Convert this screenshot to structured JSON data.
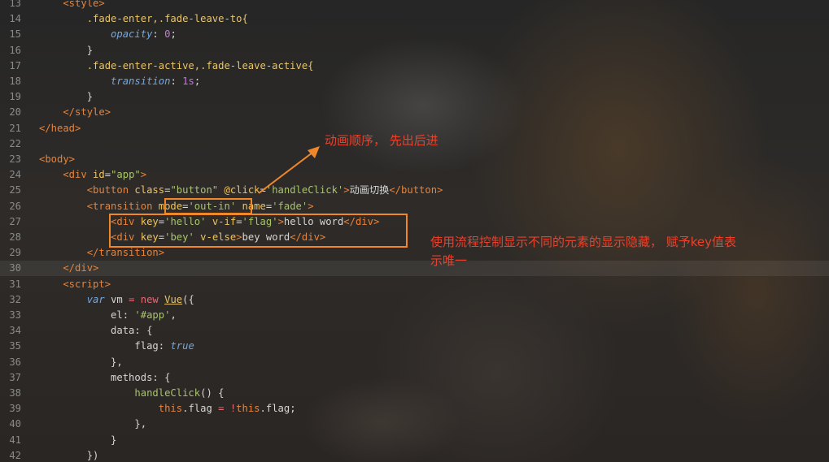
{
  "editor": {
    "line_numbers": [
      "13",
      "14",
      "15",
      "16",
      "17",
      "18",
      "19",
      "20",
      "21",
      "22",
      "23",
      "24",
      "25",
      "26",
      "27",
      "28",
      "29",
      "30",
      "31",
      "32",
      "33",
      "34",
      "35",
      "36",
      "37",
      "38",
      "39",
      "40",
      "41",
      "42"
    ],
    "active_line": "30",
    "lines": [
      [
        [
          "t-tag",
          "    <style>"
        ]
      ],
      [
        [
          "t-sel",
          "        .fade-enter,.fade-leave-to{"
        ]
      ],
      [
        [
          "t-prop",
          "            opacity"
        ],
        [
          "t-pl",
          ": "
        ],
        [
          "t-num",
          "0"
        ],
        [
          "t-pl",
          ";"
        ]
      ],
      [
        [
          "t-pl",
          "        }"
        ]
      ],
      [
        [
          "t-sel",
          "        .fade-enter-active,.fade-leave-active{"
        ]
      ],
      [
        [
          "t-prop",
          "            transition"
        ],
        [
          "t-pl",
          ": "
        ],
        [
          "t-num",
          "1s"
        ],
        [
          "t-pl",
          ";"
        ]
      ],
      [
        [
          "t-pl",
          "        }"
        ]
      ],
      [
        [
          "t-tag",
          "    </style>"
        ]
      ],
      [
        [
          "t-tag",
          "</head>"
        ]
      ],
      [
        [
          "t-pl",
          ""
        ]
      ],
      [
        [
          "t-tag",
          "<body>"
        ]
      ],
      [
        [
          "t-tag",
          "    <div "
        ],
        [
          "t-attr",
          "id"
        ],
        [
          "t-pl",
          "="
        ],
        [
          "t-str",
          "\"app\""
        ],
        [
          "t-tag",
          ">"
        ]
      ],
      [
        [
          "t-tag",
          "        <button "
        ],
        [
          "t-attr",
          "class"
        ],
        [
          "t-pl",
          "="
        ],
        [
          "t-str",
          "\"button\""
        ],
        [
          "t-pl",
          " "
        ],
        [
          "t-attr",
          "@click"
        ],
        [
          "t-pl",
          "="
        ],
        [
          "t-str",
          "'handleClick'"
        ],
        [
          "t-tag",
          ">"
        ],
        [
          "t-pl t-cjk",
          "动画切换"
        ],
        [
          "t-tag",
          "</button>"
        ]
      ],
      [
        [
          "t-tag",
          "        <transition "
        ],
        [
          "t-attr",
          "mode"
        ],
        [
          "t-pl",
          "="
        ],
        [
          "t-str",
          "'out-in'"
        ],
        [
          "t-pl",
          " "
        ],
        [
          "t-attr",
          "name"
        ],
        [
          "t-pl",
          "="
        ],
        [
          "t-str",
          "'fade'"
        ],
        [
          "t-tag",
          ">"
        ]
      ],
      [
        [
          "t-tag",
          "            <div "
        ],
        [
          "t-attr",
          "key"
        ],
        [
          "t-pl",
          "="
        ],
        [
          "t-str",
          "'hello'"
        ],
        [
          "t-pl",
          " "
        ],
        [
          "t-attr",
          "v-if"
        ],
        [
          "t-pl",
          "="
        ],
        [
          "t-str",
          "'flag'"
        ],
        [
          "t-tag",
          ">"
        ],
        [
          "t-pl",
          "hello word"
        ],
        [
          "t-tag",
          "</div>"
        ]
      ],
      [
        [
          "t-tag",
          "            <div "
        ],
        [
          "t-attr",
          "key"
        ],
        [
          "t-pl",
          "="
        ],
        [
          "t-str",
          "'bey'"
        ],
        [
          "t-pl",
          " "
        ],
        [
          "t-attr",
          "v-else"
        ],
        [
          "t-tag",
          ">"
        ],
        [
          "t-pl",
          "bey word"
        ],
        [
          "t-tag",
          "</div>"
        ]
      ],
      [
        [
          "t-tag",
          "        </transition>"
        ]
      ],
      [
        [
          "t-tag",
          "    </div>"
        ]
      ],
      [
        [
          "t-tag",
          "    <script>"
        ]
      ],
      [
        [
          "t-kwi",
          "        var "
        ],
        [
          "t-pl",
          "vm "
        ],
        [
          "t-kw",
          "="
        ],
        [
          "t-kw",
          " new "
        ],
        [
          "t-ctor",
          "Vue"
        ],
        [
          "t-pl",
          "({"
        ]
      ],
      [
        [
          "t-pl",
          "            el: "
        ],
        [
          "t-str",
          "'#app'"
        ],
        [
          "t-pl",
          ","
        ]
      ],
      [
        [
          "t-pl",
          "            data: {"
        ]
      ],
      [
        [
          "t-pl",
          "                flag: "
        ],
        [
          "t-prop",
          "true"
        ]
      ],
      [
        [
          "t-pl",
          "            },"
        ]
      ],
      [
        [
          "t-pl",
          "            methods: {"
        ]
      ],
      [
        [
          "t-fn",
          "                handleClick"
        ],
        [
          "t-pl",
          "() {"
        ]
      ],
      [
        [
          "t-this",
          "                    this"
        ],
        [
          "t-pl",
          ".flag "
        ],
        [
          "t-kw",
          "="
        ],
        [
          "t-pl",
          " "
        ],
        [
          "t-kw",
          "!"
        ],
        [
          "t-this",
          "this"
        ],
        [
          "t-pl",
          ".flag;"
        ]
      ],
      [
        [
          "t-pl",
          "                },"
        ]
      ],
      [
        [
          "t-pl",
          "            }"
        ]
      ],
      [
        [
          "t-pl",
          "        })"
        ]
      ]
    ]
  },
  "annotations": {
    "arrow_note": "动画顺序， 先出后进",
    "box_note_line1": "使用流程控制显示不同的元素的显示隐藏， 赋予key值表",
    "box_note_line2": "示唯一"
  },
  "colors": {
    "annotation_box": "#f0882a",
    "annotation_text": "#e8412c"
  }
}
